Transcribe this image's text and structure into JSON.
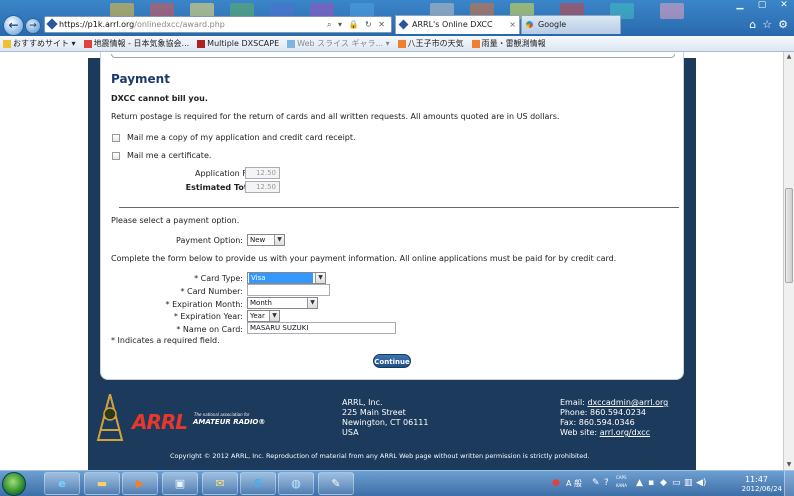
{
  "browser": {
    "url_main": "https://p1k.arrl.org",
    "url_path": "/onlinedxcc/award.php",
    "address_tools": "⌕ ▾ 🔒 ↻ ✕",
    "tabs": [
      {
        "label": "ARRL's Online DXCC",
        "close": "×"
      },
      {
        "label": "Google"
      }
    ],
    "favorites": [
      {
        "label": "おすすめサイト ▾"
      },
      {
        "label": "地震情報 - 日本気象協会..."
      },
      {
        "label": "Multiple DXSCAPE"
      },
      {
        "label": "Web スライス ギャラ... ▾"
      },
      {
        "label": "八王子市の天気"
      },
      {
        "label": "雨量・雷観測情報"
      }
    ]
  },
  "page": {
    "title": "Payment",
    "no_bill": "DXCC cannot bill you.",
    "postage_note": "Return postage is required for the return of cards and all written requests. All amounts quoted are in US dollars.",
    "mail_copy_label": "Mail me a copy of my application and credit card receipt.",
    "mail_cert_label": "Mail me a certificate.",
    "application_fee_label": "Application Fee:",
    "application_fee_value": "12.50",
    "estimated_total_label": "Estimated Total:",
    "estimated_total_value": "12.50",
    "select_option_text": "Please select a payment option.",
    "payment_option_label": "Payment Option:",
    "payment_option_value": "New",
    "complete_form_text": "Complete the form below to provide us with your payment information. All online applications must be paid for by credit card.",
    "card_type_label": "* Card Type:",
    "card_type_value": "Visa",
    "card_number_label": "* Card Number:",
    "card_number_value": "",
    "exp_month_label": "* Expiration Month:",
    "exp_month_value": "Month",
    "exp_year_label": "* Expiration Year:",
    "exp_year_value": "Year",
    "name_label": "* Name on Card:",
    "name_value": "MASARU SUZUKI",
    "required_note": "* Indicates a required field.",
    "continue_label": "Continue"
  },
  "footer": {
    "logo_text": "ARRL",
    "logo_tagline": "The national association for",
    "logo_tagline2": "AMATEUR RADIO®",
    "address": [
      "ARRL, Inc.",
      "225 Main Street",
      "Newington, CT 06111",
      "USA"
    ],
    "email_label": "Email:",
    "email": "dxccadmin@arrl.org",
    "phone": "Phone: 860.594.0234",
    "fax": "Fax: 860.594.0346",
    "website_label": "Web site:",
    "website": "arrl.org/dxcc",
    "copyright": "Copyright © 2012 ARRL, Inc. Reproduction of material from any ARRL Web page without written permission is strictly prohibited."
  },
  "taskbar": {
    "ime": "A 般",
    "caps": "CAPS",
    "kana": "KANA",
    "time": "11:47",
    "date": "2012/06/24"
  },
  "colors": {
    "page_bg": "#1b3a5c",
    "heading": "#1d3b6a",
    "arrl_red": "#e8382b",
    "continue_btn": "#2a5f99",
    "selection": "#3399ff"
  }
}
